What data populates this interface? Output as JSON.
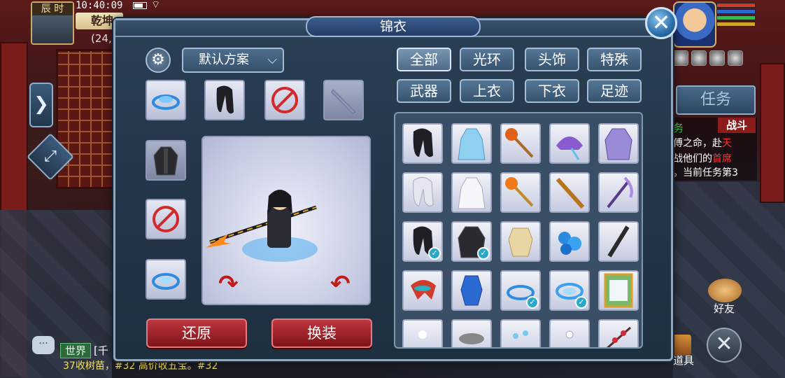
{
  "hud": {
    "time_label": "辰 时",
    "clock": "10:40:09",
    "location": "乾坤",
    "coords": "(24,",
    "task_tab": "任务",
    "task_title": "务",
    "battle_tag": "战斗",
    "task_lines": [
      {
        "text": "傅之命，赴",
        "red": "天"
      },
      {
        "text": "战他们的",
        "red": "首席"
      },
      {
        "text": "。当前任务第3",
        "red": ""
      }
    ],
    "friends_label": "好友",
    "bag_label": "道具",
    "world_tag": "世界",
    "chat_line1": "[千",
    "chat_line2": "37收树苗，#32   高价收五宝。#32"
  },
  "panel": {
    "title": "锦衣",
    "scheme_select": "默认方案",
    "tabs": [
      {
        "label": "全部",
        "active": true
      },
      {
        "label": "光环",
        "active": false
      },
      {
        "label": "头饰",
        "active": false
      },
      {
        "label": "特殊",
        "active": false
      },
      {
        "label": "武器",
        "active": false
      },
      {
        "label": "上衣",
        "active": false
      },
      {
        "label": "下衣",
        "active": false
      },
      {
        "label": "足迹",
        "active": false
      }
    ],
    "restore_button": "还原",
    "change_button": "换装"
  },
  "colors": {
    "accent_blue": "#2a6ea8",
    "button_red": "#c0353d",
    "check_teal": "#2aa8c8",
    "panel_bg": "#2b3f55"
  }
}
